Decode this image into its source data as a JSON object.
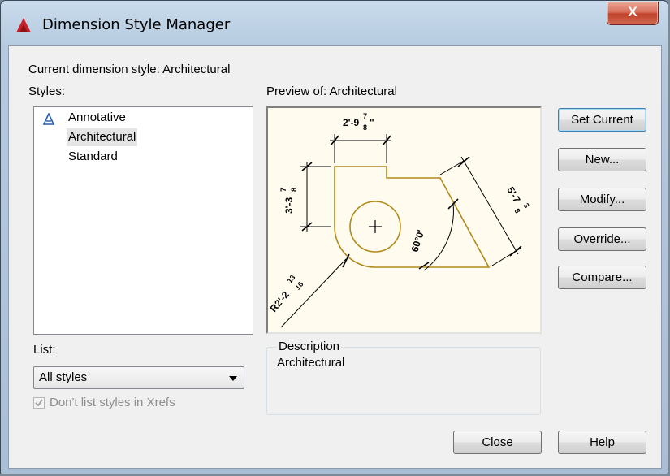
{
  "window": {
    "title": "Dimension Style Manager",
    "close_label": "X"
  },
  "current_style": "Current dimension style: Architectural",
  "styles": {
    "label": "Styles:",
    "items": [
      {
        "label": "Annotative",
        "icon": "annotative-icon"
      },
      {
        "label": "Architectural",
        "selected": true
      },
      {
        "label": "Standard"
      }
    ]
  },
  "preview": {
    "label": "Preview of: Architectural",
    "dims": {
      "top": "2'-9",
      "top_frac_num": "7",
      "top_frac_den": "8",
      "top_suffix": "\"",
      "left": "3'-3",
      "left_frac_num": "7",
      "left_frac_den": "8",
      "right": "5'-7",
      "right_frac_num": "3",
      "right_frac_den": "8",
      "angle": "60°0'",
      "radius": "R2'-2",
      "radius_frac_num": "13",
      "radius_frac_den": "16"
    }
  },
  "buttons": {
    "set_current": "Set Current",
    "new": "New...",
    "modify": "Modify...",
    "override": "Override...",
    "compare": "Compare...",
    "close": "Close",
    "help": "Help"
  },
  "list": {
    "label": "List:",
    "selected": "All styles",
    "xref_checkbox": "Don't list styles in Xrefs",
    "xref_checked": true
  },
  "description": {
    "label": "Description",
    "text": "Architectural"
  }
}
